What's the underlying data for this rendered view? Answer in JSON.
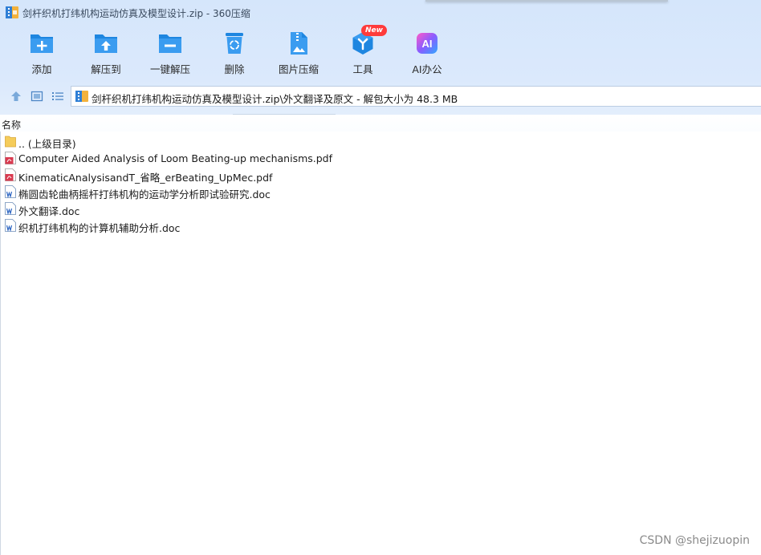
{
  "window": {
    "title": "剑杆织机打纬机构运动仿真及模型设计.zip - 360压缩"
  },
  "toolbar": {
    "items": [
      {
        "label": "添加",
        "icon": "add-icon"
      },
      {
        "label": "解压到",
        "icon": "extract-to-icon"
      },
      {
        "label": "一键解压",
        "icon": "one-click-extract-icon"
      },
      {
        "label": "删除",
        "icon": "delete-icon"
      },
      {
        "label": "图片压缩",
        "icon": "image-compress-icon"
      },
      {
        "label": "工具",
        "icon": "tools-icon",
        "badge": "New"
      },
      {
        "label": "AI办公",
        "icon": "ai-office-icon",
        "glyph": "AI"
      }
    ]
  },
  "address": {
    "path": "剑杆织机打纬机构运动仿真及模型设计.zip\\外文翻译及原文 - 解包大小为 48.3 MB"
  },
  "columns": {
    "name": "名称"
  },
  "files": [
    {
      "name": ".. (上级目录)",
      "type": "folder"
    },
    {
      "name": "Computer Aided Analysis of Loom Beating-up mechanisms.pdf",
      "type": "pdf"
    },
    {
      "name": "KinematicAnalysisandT_省略_erBeating_UpMec.pdf",
      "type": "pdf"
    },
    {
      "name": "椭圆齿轮曲柄摇杆打纬机构的运动学分析即试验研究.doc",
      "type": "doc"
    },
    {
      "name": "外文翻译.doc",
      "type": "doc"
    },
    {
      "name": "织机打纬机构的计算机辅助分析.doc",
      "type": "doc"
    }
  ],
  "watermark": "CSDN @shejizuopin",
  "colors": {
    "accent_blue": "#1e86e0",
    "pdf_red": "#d93a4f",
    "doc_blue": "#2b64c2",
    "folder_yellow": "#f5cc5a",
    "badge_red": "#ff3b3b"
  }
}
